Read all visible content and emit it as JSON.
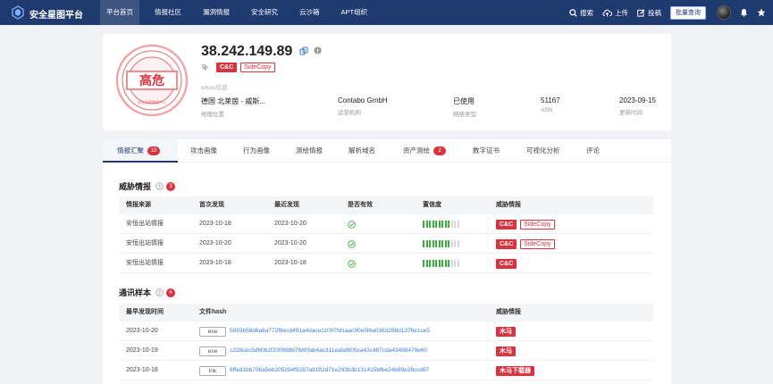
{
  "nav": {
    "brand": "安全星图平台",
    "menu": [
      "平台首页",
      "情报社区",
      "漏洞情报",
      "安全研究",
      "云沙箱",
      "APT组织"
    ],
    "active_index": 0,
    "search_label": "搜索",
    "upload_label": "上传",
    "submit_label": "投稿",
    "batch_label": "批量查询"
  },
  "ip_card": {
    "ip": "38.242.149.89",
    "risk_level": "高危",
    "tags": [
      "C&C",
      "SideCopy"
    ],
    "whois_label": "whois信息",
    "info": [
      {
        "value": "德国 北莱茵 - 威斯...",
        "label": "地理位置"
      },
      {
        "value": "Contabo GmbH",
        "label": "运营机构"
      },
      {
        "value": "已使用",
        "label": "网络类型"
      },
      {
        "value": "51167",
        "label": "ASN"
      },
      {
        "value": "2023-09-15",
        "label": "更新时间"
      }
    ]
  },
  "tabs": [
    {
      "label": "情报汇聚",
      "badge": "10"
    },
    {
      "label": "攻击画像",
      "badge": ""
    },
    {
      "label": "行为画像",
      "badge": ""
    },
    {
      "label": "测绘情报",
      "badge": ""
    },
    {
      "label": "解析域名",
      "badge": ""
    },
    {
      "label": "资产测绘",
      "badge": "2"
    },
    {
      "label": "数字证书",
      "badge": ""
    },
    {
      "label": "可视化分析",
      "badge": ""
    },
    {
      "label": "评论",
      "badge": ""
    }
  ],
  "threat_section": {
    "title": "威胁情报",
    "count": "3",
    "columns": [
      "情报来源",
      "首次发现",
      "最近发现",
      "是否有效",
      "置信度",
      "威胁情报"
    ],
    "rows": [
      {
        "source": "安恒出站情报",
        "first": "2023-10-18",
        "last": "2023-10-20",
        "confidence": 0.75,
        "tags": [
          "C&C",
          "SideCopy"
        ]
      },
      {
        "source": "安恒出站情报",
        "first": "2023-10-20",
        "last": "2023-10-20",
        "confidence": 0.75,
        "tags": [
          "C&C",
          "SideCopy"
        ]
      },
      {
        "source": "安恒出站情报",
        "first": "2023-10-18",
        "last": "2023-10-18",
        "confidence": 0.75,
        "tags": [
          "C&C"
        ]
      }
    ]
  },
  "sample_section": {
    "title": "通讯样本",
    "count": "4",
    "columns": [
      "最早发现时间",
      "文件hash",
      "威胁情报"
    ],
    "rows": [
      {
        "date": "2023-10-20",
        "type": "exe",
        "hash": "5893b58d6a6a772f8ecd491a4dace11007fd1aac90e5f4a0363288d1376e1ce5",
        "tag": "木马"
      },
      {
        "date": "2023-10-19",
        "type": "exe",
        "hash": "c328cec5d6062f200998b7680fab4ac311eafaf805ca43c487cda43498479e60",
        "tag": "木马"
      },
      {
        "date": "2023-10-18",
        "type": "lnk",
        "hash": "6ffed1bb706a5eb205294f9287a9182d71e293b3b131415bfbe24b99e28ccd67",
        "tag": "木马下载器"
      }
    ]
  }
}
